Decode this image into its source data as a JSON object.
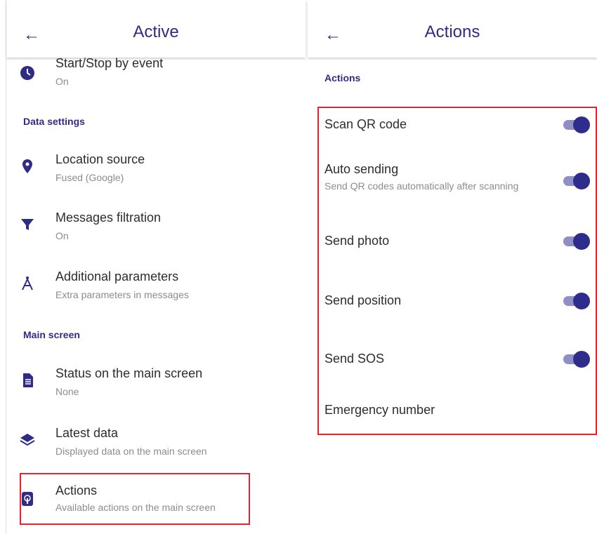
{
  "left": {
    "title": "Active",
    "back_icon": "arrow-left",
    "first_item": {
      "title": "Start/Stop by event",
      "subtitle": "On",
      "icon": "clock-icon"
    },
    "data_settings": {
      "header": "Data settings",
      "items": [
        {
          "title": "Location source",
          "subtitle": "Fused (Google)",
          "icon": "location-pin-icon"
        },
        {
          "title": "Messages filtration",
          "subtitle": "On",
          "icon": "filter-icon"
        },
        {
          "title": "Additional parameters",
          "subtitle": "Extra parameters in messages",
          "icon": "compass-icon"
        }
      ]
    },
    "main_screen": {
      "header": "Main screen",
      "items": [
        {
          "title": "Status on the main screen",
          "subtitle": "None",
          "icon": "document-list-icon"
        },
        {
          "title": "Latest data",
          "subtitle": "Displayed data on the main screen",
          "icon": "layers-icon"
        },
        {
          "title": "Actions",
          "subtitle": "Available actions on the main screen",
          "icon": "touch-icon"
        }
      ]
    }
  },
  "right": {
    "title": "Actions",
    "back_icon": "arrow-left",
    "section_header": "Actions",
    "items": [
      {
        "title": "Scan QR code",
        "toggle": true
      },
      {
        "title": "Auto sending",
        "subtitle": "Send QR codes automatically after scanning",
        "toggle": true
      },
      {
        "title": "Send photo",
        "toggle": true
      },
      {
        "title": "Send position",
        "toggle": true
      },
      {
        "title": "Send SOS",
        "toggle": true
      },
      {
        "title": "Emergency number"
      }
    ]
  },
  "colors": {
    "accent": "#302b84",
    "highlight": "#e3232d",
    "toggle_thumb": "#2f2d8c",
    "toggle_track": "#8f8ec6"
  }
}
